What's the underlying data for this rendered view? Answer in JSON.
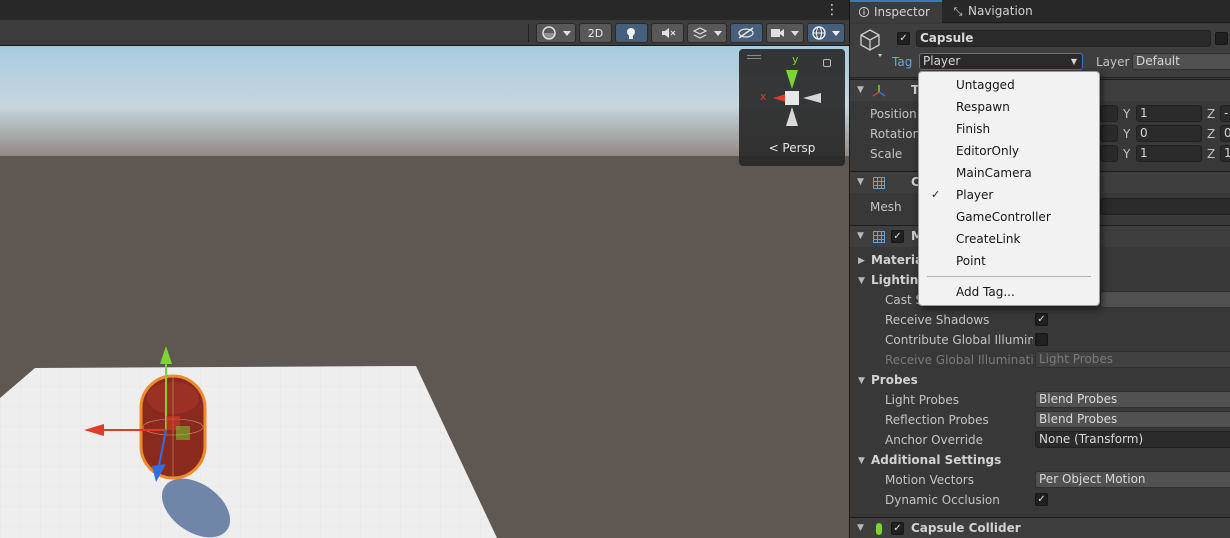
{
  "toolbar": {
    "btn_2d": "2D"
  },
  "gizmo": {
    "y_label": "y",
    "x_label": "x",
    "persp_label": "< Persp"
  },
  "tabs": [
    {
      "label": "Inspector",
      "icon": "info-icon"
    },
    {
      "label": "Navigation",
      "icon": "navigation-icon"
    }
  ],
  "gameobject": {
    "name": "Capsule",
    "active": true,
    "tag_label": "Tag",
    "tag_value": "Player",
    "layer_label": "Layer",
    "layer_value": "Default"
  },
  "transform": {
    "header_partial": "T",
    "position_label": "Position",
    "rotation_label": "Rotation",
    "scale_label": "Scale",
    "y_label": "Y",
    "z_label": "Z",
    "position_y": "1",
    "rotation_y": "0",
    "scale_y": "1",
    "position_z": "-",
    "rotation_z": "0",
    "scale_z": "1"
  },
  "mesh_filter": {
    "header_partial": "C",
    "mesh_label": "Mesh"
  },
  "mesh_renderer": {
    "header_partial": "M",
    "materials_label": "Material",
    "lighting_label": "Lighting",
    "cast_shadows_label": "Cast S",
    "receive_shadows_label": "Receive Shadows",
    "contribute_gi_label": "Contribute Global Illuminat",
    "receive_gi_label": "Receive Global Illumination",
    "receive_gi_value": "Light Probes",
    "probes_label": "Probes",
    "light_probes_label": "Light Probes",
    "light_probes_value": "Blend Probes",
    "reflection_probes_label": "Reflection Probes",
    "reflection_probes_value": "Blend Probes",
    "anchor_override_label": "Anchor Override",
    "anchor_override_value": "None (Transform)",
    "additional_settings_label": "Additional Settings",
    "motion_vectors_label": "Motion Vectors",
    "motion_vectors_value": "Per Object Motion",
    "dynamic_occlusion_label": "Dynamic Occlusion"
  },
  "capsule_collider": {
    "label": "Capsule Collider"
  },
  "tag_dropdown": {
    "items": [
      "Untagged",
      "Respawn",
      "Finish",
      "EditorOnly",
      "MainCamera",
      "Player",
      "GameController",
      "CreateLink",
      "Point"
    ],
    "selected": "Player",
    "add_tag": "Add Tag..."
  },
  "colors": {
    "accent": "#3a79bb",
    "x_axis": "#e03a2a",
    "y_axis": "#7bd431",
    "z_axis": "#2f6fe0"
  }
}
